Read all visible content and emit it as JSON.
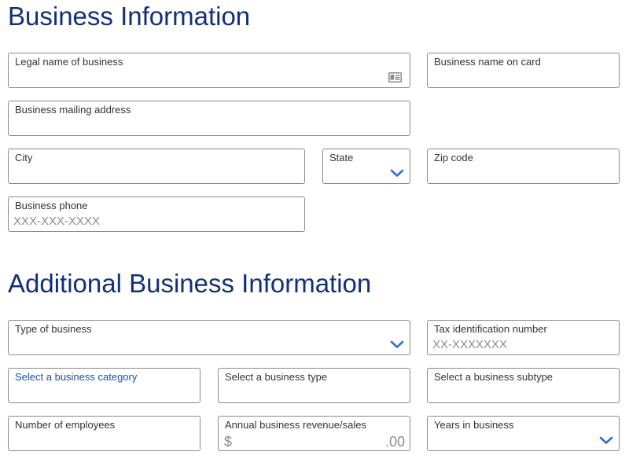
{
  "sections": {
    "business_info_title": "Business Information",
    "additional_info_title": "Additional Business Information"
  },
  "fields": {
    "legal_name": {
      "label": "Legal name of business",
      "icon": "id-card-icon"
    },
    "name_on_card": {
      "label": "Business name on card"
    },
    "mailing_address": {
      "label": "Business mailing address"
    },
    "city": {
      "label": "City"
    },
    "state": {
      "label": "State",
      "icon": "chevron-down-icon"
    },
    "zip": {
      "label": "Zip code"
    },
    "phone": {
      "label": "Business phone",
      "placeholder": "XXX-XXX-XXXX"
    },
    "type_of_business": {
      "label": "Type of business",
      "icon": "chevron-down-icon"
    },
    "tax_id": {
      "label": "Tax identification number",
      "placeholder": "XX-XXXXXXX"
    },
    "business_category": {
      "label": "Select a business category"
    },
    "business_type": {
      "label": "Select a business type"
    },
    "business_subtype": {
      "label": "Select a business subtype"
    },
    "employees": {
      "label": "Number of employees"
    },
    "revenue": {
      "label": "Annual business revenue/sales",
      "prefix": "$",
      "suffix": ".00"
    },
    "years": {
      "label": "Years in business",
      "icon": "chevron-down-icon"
    }
  },
  "colors": {
    "heading": "#142f7a",
    "accent": "#1a4cb8",
    "chevron": "#2f6fd6",
    "border": "#8a8a8a",
    "placeholder": "#8c8c8c"
  }
}
